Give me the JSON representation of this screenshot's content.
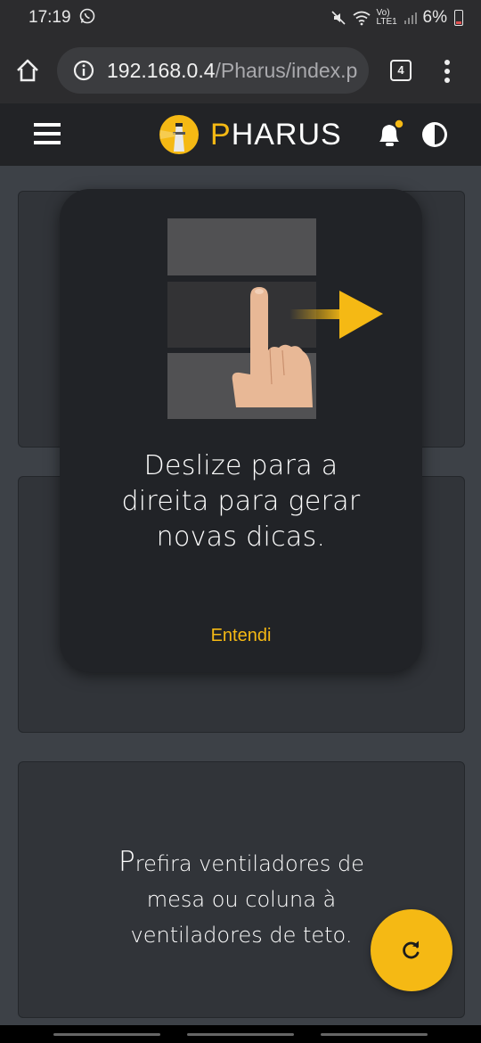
{
  "status": {
    "time": "17:19",
    "network": "Vo) LTE1",
    "battery": "6%"
  },
  "browser": {
    "url_host": "192.168.0.4",
    "url_path": "/Pharus/index.p",
    "tab_count": "4"
  },
  "app": {
    "logo_initial": "P",
    "logo_rest": "HARUS"
  },
  "modal": {
    "line1": "Deslize para a",
    "line2": "direita para gerar",
    "line3": "novas dicas.",
    "button": "Entendi"
  },
  "tip": {
    "first_letter": "P",
    "line1_rest": "refira ventiladores de",
    "line2": "mesa ou coluna à",
    "line3": "ventiladores de teto."
  },
  "colors": {
    "accent": "#f5b914",
    "background": "#3d4147",
    "card": "#313439",
    "header": "#222326"
  }
}
